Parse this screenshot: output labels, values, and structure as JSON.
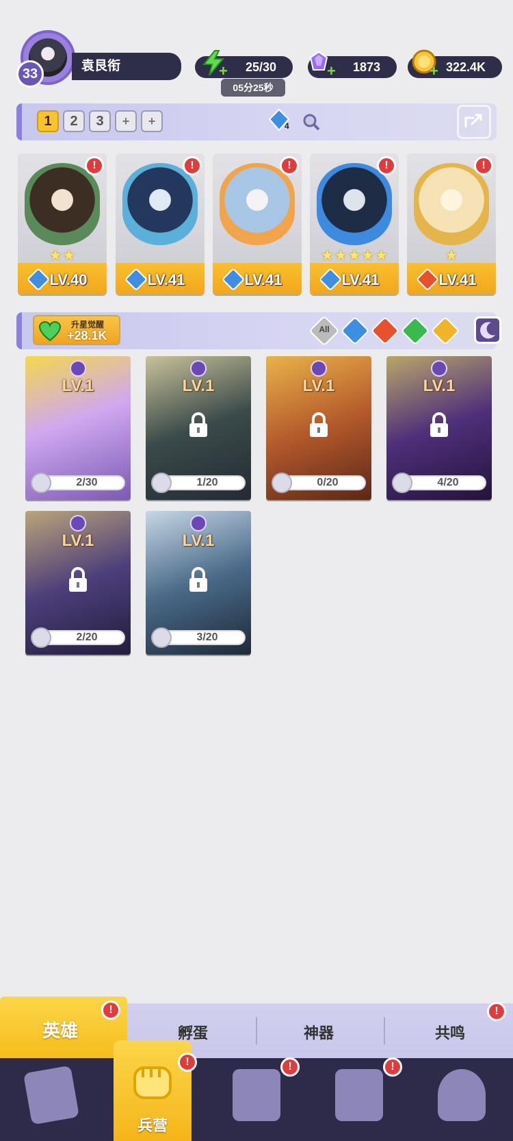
{
  "player": {
    "level": "33",
    "name": "袁艮衔"
  },
  "resources": {
    "energy": "25/30",
    "energy_timer": "05分25秒",
    "gems": "1873",
    "gold": "322.4K"
  },
  "team": {
    "slots": [
      "1",
      "2",
      "3",
      "+",
      "+"
    ],
    "active_slot": "1",
    "gem_badge": "4"
  },
  "heroes": [
    {
      "level": "LV.40",
      "stars": "★★",
      "element": "water",
      "alert": "!"
    },
    {
      "level": "LV.41",
      "stars": "",
      "element": "water",
      "alert": "!"
    },
    {
      "level": "LV.41",
      "stars": "",
      "element": "water",
      "alert": "!"
    },
    {
      "level": "LV.41",
      "stars": "★★★★★",
      "element": "water",
      "alert": "!"
    },
    {
      "level": "LV.41",
      "stars": "★",
      "element": "fire",
      "alert": "!"
    }
  ],
  "awaken": {
    "label": "升星觉醒",
    "value": "+28.1K"
  },
  "filters": {
    "all_label": "All",
    "items": [
      "water",
      "fire",
      "wind",
      "light",
      "dark"
    ],
    "active": "dark"
  },
  "locked_heroes": [
    {
      "level": "LV.1",
      "progress": "2/30",
      "locked": false,
      "theme": "#cfa8f0"
    },
    {
      "level": "LV.1",
      "progress": "1/20",
      "locked": true,
      "theme": "#3b4a4a"
    },
    {
      "level": "LV.1",
      "progress": "0/20",
      "locked": true,
      "theme": "#b55a2c"
    },
    {
      "level": "LV.1",
      "progress": "4/20",
      "locked": true,
      "theme": "#4e2f7a"
    },
    {
      "level": "LV.1",
      "progress": "2/20",
      "locked": true,
      "theme": "#4c3f7a"
    },
    {
      "level": "LV.1",
      "progress": "3/20",
      "locked": true,
      "theme": "#4a6a88"
    }
  ],
  "tabs": {
    "hero": "英雄",
    "hatch": "孵蛋",
    "artifact": "神器",
    "resonance": "共鸣"
  },
  "nav": {
    "barracks": "兵营"
  },
  "colors": {
    "accent": "#8b7fe6",
    "gold": "#f6bd1c",
    "alert": "#e23b3b",
    "dark": "#2d2b49"
  }
}
